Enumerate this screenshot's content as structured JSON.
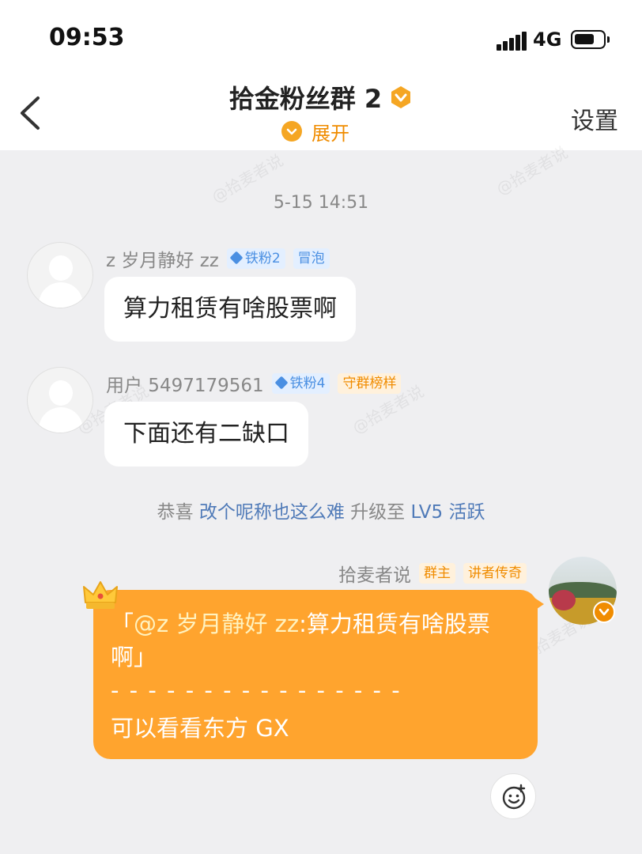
{
  "status_bar": {
    "time": "09:53",
    "network": "4G"
  },
  "header": {
    "title": "拾金粉丝群 2",
    "expand_label": "展开",
    "settings_label": "设置"
  },
  "watermark_text": "@拾麦者说",
  "chat": {
    "timestamp": "5-15 14:51",
    "messages": [
      {
        "username": "z 岁月静好 zz",
        "badges": [
          "铁粉2",
          "冒泡"
        ],
        "text": "算力租赁有啥股票啊"
      },
      {
        "username": "用户 5497179561",
        "badges": [
          "铁粉4",
          "守群榜样"
        ],
        "text": "下面还有二缺口"
      }
    ],
    "system": {
      "prefix": "恭喜",
      "name": "改个呢称也这么难",
      "middle": "升级至",
      "level": "LV5 活跃"
    },
    "own_message": {
      "username": "拾麦者说",
      "badges": [
        "群主",
        "讲者传奇"
      ],
      "quote_open": "「",
      "quote_mention": "@z 岁月静好 zz",
      "quote_text": ":算力租赁有啥股票啊」",
      "divider": "- - - - - - - - - - - - - - - -",
      "reply": "可以看看东方 GX"
    }
  },
  "colors": {
    "accent": "#ffa42e",
    "badge_blue": "#4a8fe2",
    "badge_orange": "#f08c00",
    "link": "#4f7ab8"
  }
}
